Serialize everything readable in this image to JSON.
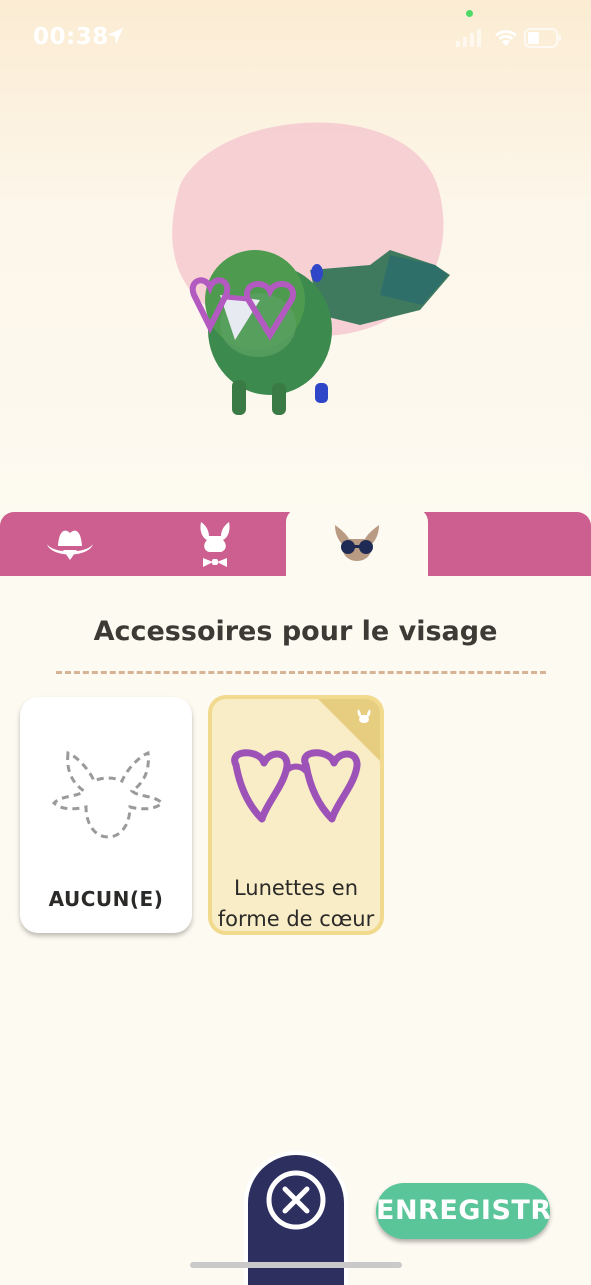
{
  "status_bar": {
    "time": "00:38"
  },
  "tabs": [
    {
      "name": "hat",
      "icon": "cowboy-hat-icon"
    },
    {
      "name": "outfit",
      "icon": "bunny-bowtie-icon"
    },
    {
      "name": "face",
      "icon": "face-glasses-icon",
      "selected": true
    }
  ],
  "section": {
    "title": "Accessoires pour le visage"
  },
  "items": [
    {
      "label": "AUCUN(E)",
      "icon": "pokemon-outline-icon"
    },
    {
      "label_line1": "Lunettes en",
      "label_line2": "forme de cœur",
      "icon": "heart-glasses-icon",
      "selected": true
    }
  ],
  "buttons": {
    "close_icon": "close-icon",
    "save_label": "ENREGISTRE"
  },
  "colors": {
    "tab_bar": "#cc5f8f",
    "save_button": "#5bc59a",
    "close_button": "#2d2f5e",
    "selected_card": "#f8edc6"
  }
}
